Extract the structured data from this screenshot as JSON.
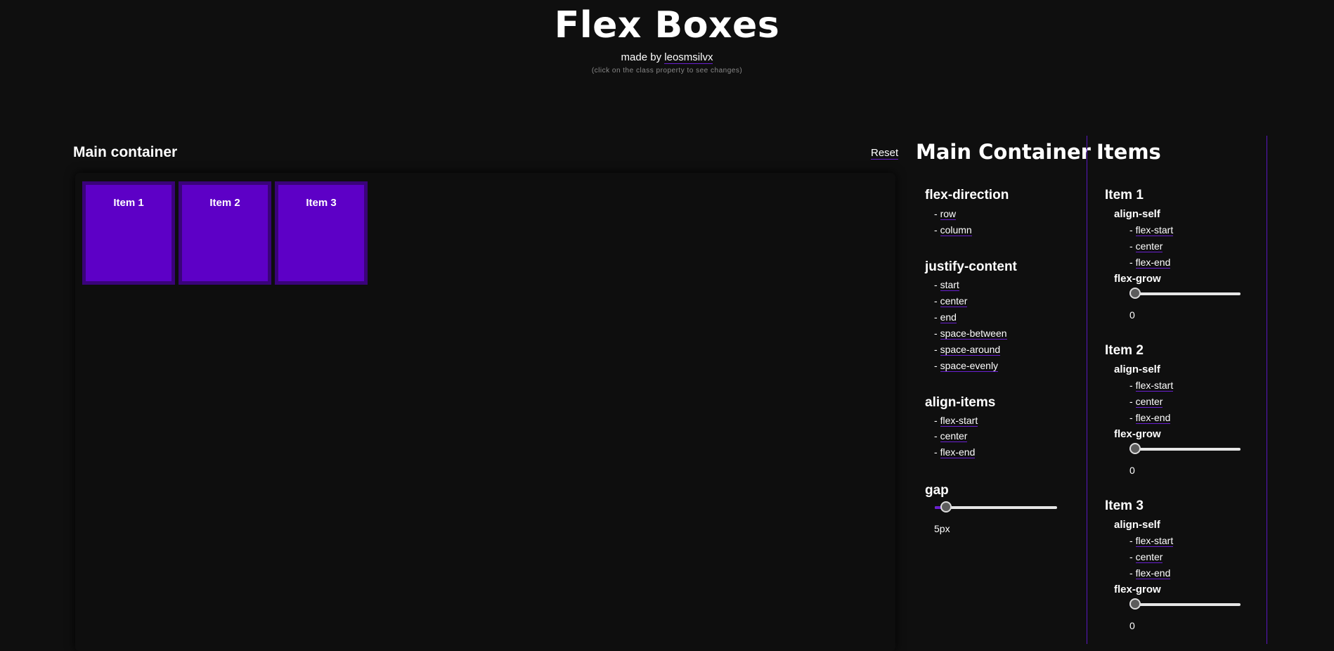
{
  "header": {
    "title": "Flex Boxes",
    "made_by_prefix": "made by",
    "author": "leosmsilvx",
    "hint": "(click on the class property to see changes)"
  },
  "main": {
    "heading": "Main container",
    "reset_label": "Reset",
    "items": [
      "Item 1",
      "Item 2",
      "Item 3"
    ]
  },
  "controls": {
    "heading": "Main Container",
    "flex_direction": {
      "title": "flex-direction",
      "options": [
        "row",
        "column"
      ]
    },
    "justify_content": {
      "title": "justify-content",
      "options": [
        "start",
        "center",
        "end",
        "space-between",
        "space-around",
        "space-evenly"
      ]
    },
    "align_items": {
      "title": "align-items",
      "options": [
        "flex-start",
        "center",
        "flex-end"
      ]
    },
    "gap": {
      "title": "gap",
      "value": "5px",
      "level": 0.05
    }
  },
  "items_panel": {
    "heading": "Items",
    "items": [
      {
        "name": "Item 1",
        "align_self_label": "align-self",
        "options": [
          "flex-start",
          "center",
          "flex-end"
        ],
        "flex_grow_label": "flex-grow",
        "value": "0",
        "level": 0
      },
      {
        "name": "Item 2",
        "align_self_label": "align-self",
        "options": [
          "flex-start",
          "center",
          "flex-end"
        ],
        "flex_grow_label": "flex-grow",
        "value": "0",
        "level": 0
      },
      {
        "name": "Item 3",
        "align_self_label": "align-self",
        "options": [
          "flex-start",
          "center",
          "flex-end"
        ],
        "flex_grow_label": "flex-grow",
        "value": "0",
        "level": 0
      }
    ]
  },
  "colors": {
    "accent": "#6a1fd1",
    "item": "#5d00c6",
    "item_border": "#3a037a",
    "background": "#0f0f0f"
  }
}
